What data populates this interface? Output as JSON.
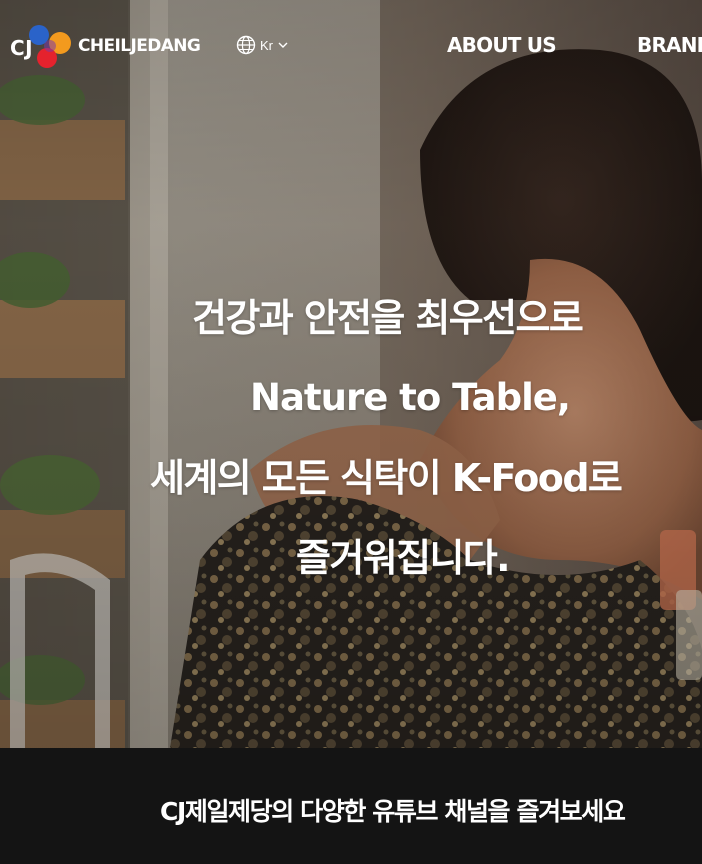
{
  "header": {
    "logo": {
      "cj_text": "CJ",
      "wordmark": "CHEILJEDANG",
      "colors": {
        "blue": "#2a63c9",
        "orange": "#f39a1e",
        "red": "#e5222d"
      }
    },
    "language": {
      "icon": "globe-icon",
      "label": "Kr",
      "chevron_icon": "chevron-down-icon"
    },
    "nav": [
      {
        "label": "ABOUT US"
      },
      {
        "label": "BRAND"
      }
    ]
  },
  "hero": {
    "headline_lines": [
      "건강과 안전을 최우선으로",
      "Nature to Table,",
      "세계의 모든 식탁이 K-Food로",
      "즐거워집니다."
    ]
  },
  "youtube_bar": {
    "text": "CJ제일제당의 다양한 유튜브 채널을 즐겨보세요"
  },
  "colors": {
    "text": "#ffffff",
    "bottom_bar": "#141414"
  }
}
